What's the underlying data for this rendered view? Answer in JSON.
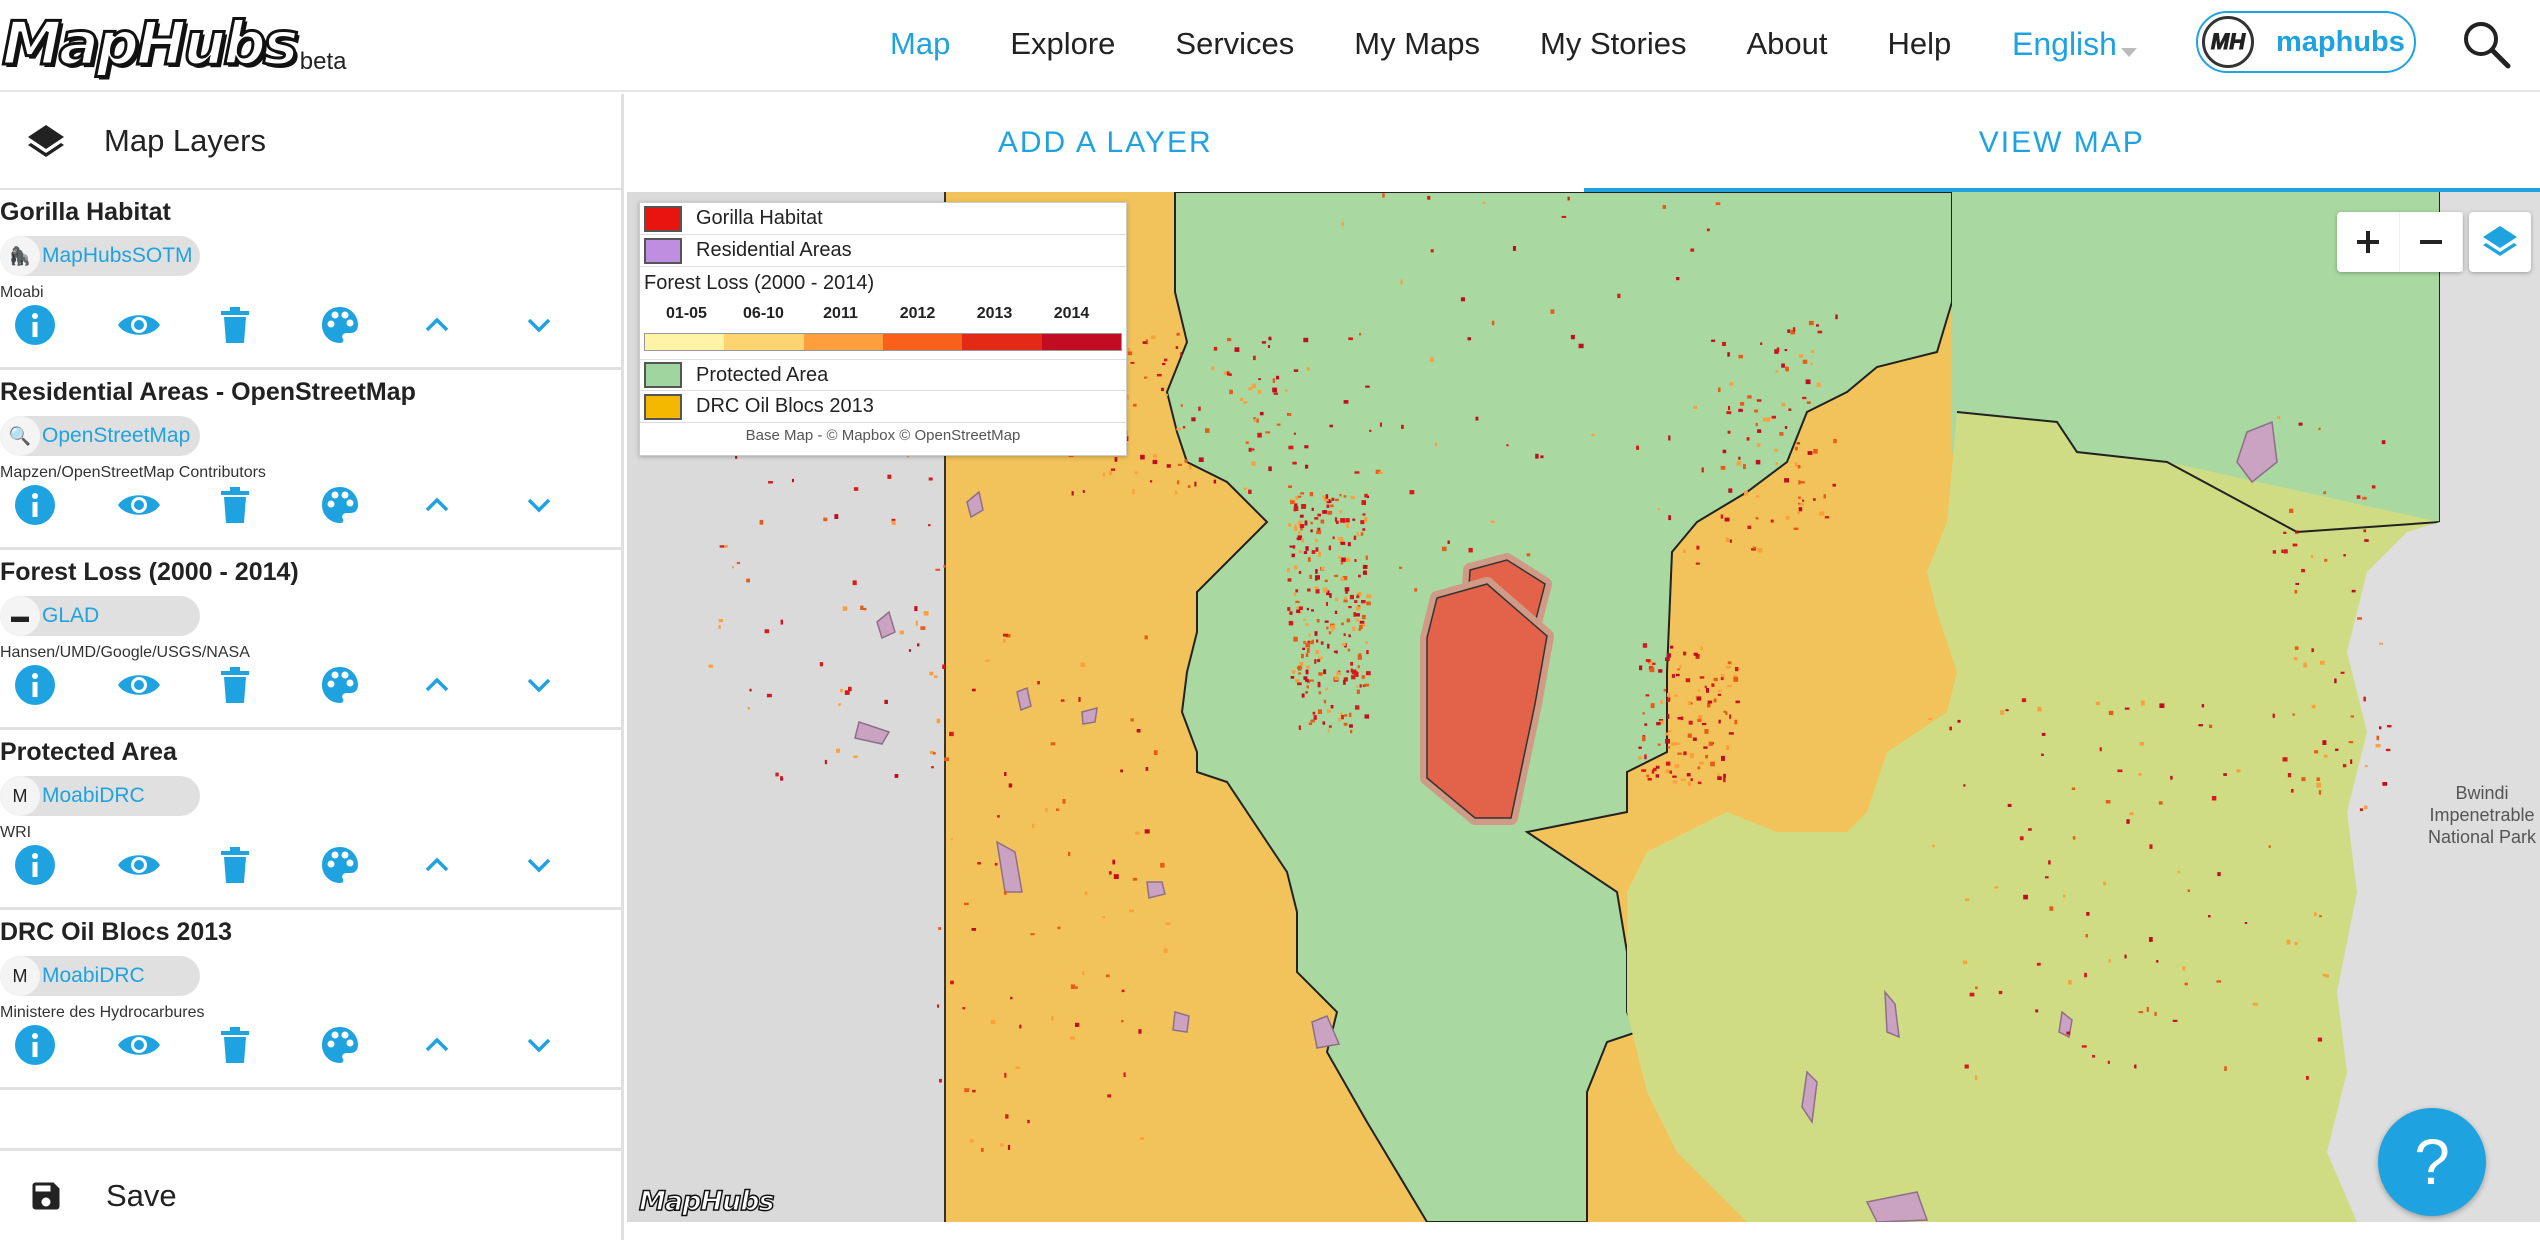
{
  "header": {
    "logo_text": "MapHubs",
    "logo_beta": "beta",
    "nav": [
      "Map",
      "Explore",
      "Services",
      "My Maps",
      "My Stories",
      "About",
      "Help"
    ],
    "active_nav": "Map",
    "language": "English",
    "user": {
      "avatar_text": "MH",
      "name": "maphubs"
    },
    "icons": {
      "search": "search-icon",
      "language_caret": "caret-down-icon"
    }
  },
  "sidebar": {
    "title": "Map Layers",
    "layers": [
      {
        "title": "Gorilla Habitat",
        "chip": "MapHubsSOTM",
        "source": "Moabi"
      },
      {
        "title": "Residential Areas - OpenStreetMap",
        "chip": "OpenStreetMap",
        "source": "Mapzen/OpenStreetMap Contributors"
      },
      {
        "title": "Forest Loss (2000 - 2014)",
        "chip": "GLAD",
        "source": "Hansen/UMD/Google/USGS/NASA"
      },
      {
        "title": "Protected Area",
        "chip": "MoabiDRC",
        "source": "WRI"
      },
      {
        "title": "DRC Oil Blocs 2013",
        "chip": "MoabiDRC",
        "source": "Ministere des Hydrocarbures"
      }
    ],
    "layer_action_icons": [
      "info-icon",
      "eye-icon",
      "trash-icon",
      "palette-icon",
      "chevron-up-icon",
      "chevron-down-icon"
    ],
    "save_label": "Save"
  },
  "tabs": [
    {
      "label": "ADD A LAYER",
      "active": false
    },
    {
      "label": "VIEW MAP",
      "active": true
    }
  ],
  "legend": {
    "items_top": [
      {
        "label": "Gorilla Habitat",
        "color": "#e8140f"
      },
      {
        "label": "Residential Areas",
        "color": "#c08ee0"
      }
    ],
    "forest_loss_title": "Forest Loss (2000 - 2014)",
    "years": [
      "01-05",
      "06-10",
      "2011",
      "2012",
      "2013",
      "2014"
    ],
    "ramp_colors": [
      "#fff3a6",
      "#fed470",
      "#fd9f3c",
      "#f9601c",
      "#e32a16",
      "#c10c22"
    ],
    "items_bottom": [
      {
        "label": "Protected Area",
        "color": "#9fd6a0"
      },
      {
        "label": "DRC Oil Blocs 2013",
        "color": "#f5b800"
      }
    ],
    "credit": "Base Map - © Mapbox © OpenStreetMap"
  },
  "map": {
    "place_label": "Bwindi Impenetrable National Park",
    "watermark": "MapHubs",
    "colors": {
      "oil": "#f2c35a",
      "protected": "#a9d9a0",
      "overlap": "#cfdc83",
      "gorilla": "#e3634a",
      "base": "#dcdcdc"
    }
  },
  "help_label": "?",
  "colors": {
    "accent": "#1fa3e0"
  }
}
